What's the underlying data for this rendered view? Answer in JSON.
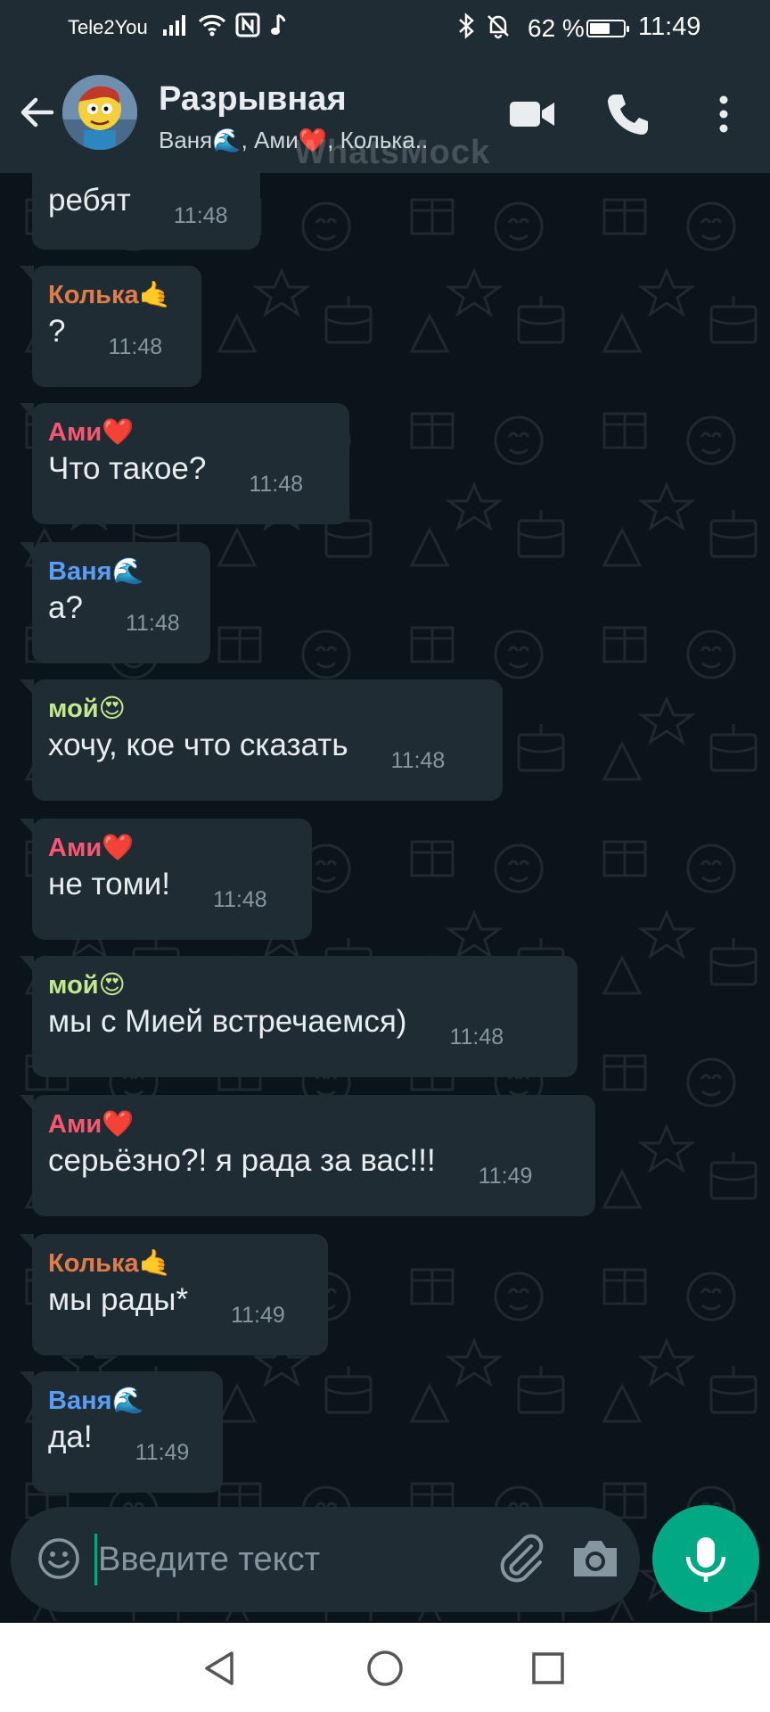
{
  "status_bar": {
    "carrier": "Tele2You",
    "battery_percent": "62 %",
    "battery_level": 0.62,
    "time": "11:49"
  },
  "header": {
    "title": "Разрывная",
    "members": "Ваня🌊, Ами❤️, Колька..",
    "watermark": "WhatsMock",
    "icons": [
      "back-arrow-icon",
      "video-call-icon",
      "phone-icon",
      "more-vertical-icon"
    ]
  },
  "colors": {
    "header_bg": "#1f2c34",
    "chat_bg": "#0b141a",
    "bubble_bg": "#202c33",
    "accent": "#00a884",
    "time_text": "#8696a0"
  },
  "messages": [
    {
      "sender": "",
      "sender_emoji": "",
      "text": "ребят",
      "time": "11:48",
      "color": "#e9edef"
    },
    {
      "sender": "Колька",
      "sender_emoji": "🤙",
      "text": "?",
      "time": "11:48",
      "color": "#e17c47"
    },
    {
      "sender": "Ами",
      "sender_emoji": "❤️",
      "text": "Что такое?",
      "time": "11:48",
      "color": "#ff5470"
    },
    {
      "sender": "Ваня",
      "sender_emoji": "🌊",
      "text": "а?",
      "time": "11:48",
      "color": "#5a9df5"
    },
    {
      "sender": "мой",
      "sender_emoji": "😍",
      "text": "хочу, кое что сказать",
      "time": "11:48",
      "color": "#c3e88d"
    },
    {
      "sender": "Ами",
      "sender_emoji": "❤️",
      "text": "не томи!",
      "time": "11:48",
      "color": "#ff5470"
    },
    {
      "sender": "мой",
      "sender_emoji": "😍",
      "text": "мы с Мией встречаемся)",
      "time": "11:48",
      "color": "#c3e88d"
    },
    {
      "sender": "Ами",
      "sender_emoji": "❤️",
      "text": "серьёзно?! я рада за вас!!!",
      "time": "11:49",
      "color": "#ff5470"
    },
    {
      "sender": "Колька",
      "sender_emoji": "🤙",
      "text": "мы рады*",
      "time": "11:49",
      "color": "#e17c47"
    },
    {
      "sender": "Ваня",
      "sender_emoji": "🌊",
      "text": "да!",
      "time": "11:49",
      "color": "#5a9df5"
    }
  ],
  "input": {
    "placeholder": "Введите текст",
    "icons": [
      "emoji-icon",
      "paperclip-icon",
      "camera-icon",
      "mic-icon"
    ]
  },
  "nav": {
    "icons": [
      "nav-back-icon",
      "nav-home-icon",
      "nav-recents-icon"
    ]
  }
}
